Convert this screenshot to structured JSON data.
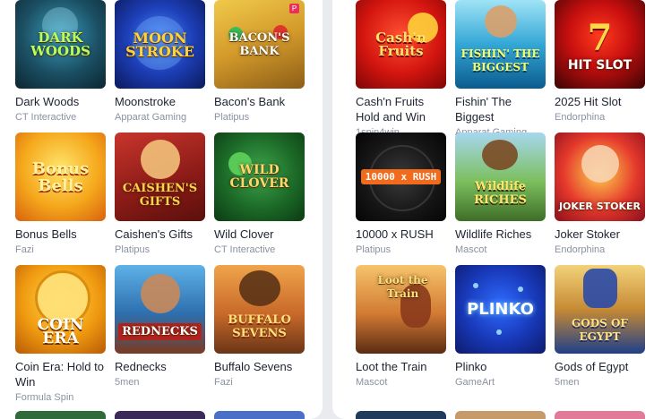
{
  "left_panel": {
    "games": [
      {
        "title": "Dark Woods",
        "provider": "CT Interactive",
        "thumb_text": "DARK WOODS"
      },
      {
        "title": "Moonstroke",
        "provider": "Apparat Gaming",
        "thumb_text": "MOON STROKE"
      },
      {
        "title": "Bacon's Bank",
        "provider": "Platipus",
        "thumb_text": "BACON'S BANK",
        "badge": "P"
      },
      {
        "title": "Bonus Bells",
        "provider": "Fazi",
        "thumb_text": "Bonus Bells"
      },
      {
        "title": "Caishen's Gifts",
        "provider": "Platipus",
        "thumb_text": "CAISHEN'S GIFTS"
      },
      {
        "title": "Wild Clover",
        "provider": "CT Interactive",
        "thumb_text": "WILD CLOVER"
      },
      {
        "title": "Coin Era: Hold to Win",
        "provider": "Formula Spin",
        "thumb_text": "COIN ERA"
      },
      {
        "title": "Rednecks",
        "provider": "5men",
        "thumb_text": "REDNECKS"
      },
      {
        "title": "Buffalo Sevens",
        "provider": "Fazi",
        "thumb_text": "BUFFALO SEVENS"
      }
    ]
  },
  "right_panel": {
    "games": [
      {
        "title": "Cash'n Fruits Hold and Win",
        "provider": "1spin4win",
        "thumb_text": "Cash'n Fruits"
      },
      {
        "title": "Fishin' The Biggest",
        "provider": "Apparat Gaming",
        "thumb_text": "FISHIN' THE BIGGEST"
      },
      {
        "title": "2025 Hit Slot",
        "provider": "Endorphina",
        "thumb_text": "HIT SLOT"
      },
      {
        "title": "10000 x RUSH",
        "provider": "Platipus",
        "thumb_text": "10000 x RUSH"
      },
      {
        "title": "Wildlife Riches",
        "provider": "Mascot",
        "thumb_text": "Wildlife RICHES"
      },
      {
        "title": "Joker Stoker",
        "provider": "Endorphina",
        "thumb_text": "JOKER STOKER"
      },
      {
        "title": "Loot the Train",
        "provider": "Mascot",
        "thumb_text": "Loot the Train"
      },
      {
        "title": "Plinko",
        "provider": "GameArt",
        "thumb_text": "PLINKO"
      },
      {
        "title": "Gods of Egypt",
        "provider": "5men",
        "thumb_text": "GODS OF EGYPT"
      }
    ]
  },
  "colors": {
    "title": "#1d2330",
    "provider": "#8a91a0",
    "panel_bg": "#ffffff",
    "page_bg": "#e9ebef"
  }
}
